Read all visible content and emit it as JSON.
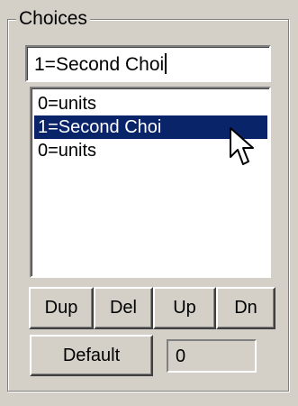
{
  "choices_group": {
    "title": "Choices",
    "edit_value": "1=Second Choi",
    "list_items": [
      {
        "label": "0=units",
        "selected": false
      },
      {
        "label": "1=Second Choi",
        "selected": true
      },
      {
        "label": "0=units",
        "selected": false
      }
    ],
    "buttons": {
      "dup": "Dup",
      "del": "Del",
      "up": "Up",
      "dn": "Dn",
      "default": "Default"
    },
    "default_value": "0"
  },
  "colors": {
    "window_background": "#d4d0c8",
    "selection_background": "#0a246a",
    "selection_text": "#ffffff"
  },
  "icons": {
    "pointer": "mouse-pointer-icon"
  }
}
